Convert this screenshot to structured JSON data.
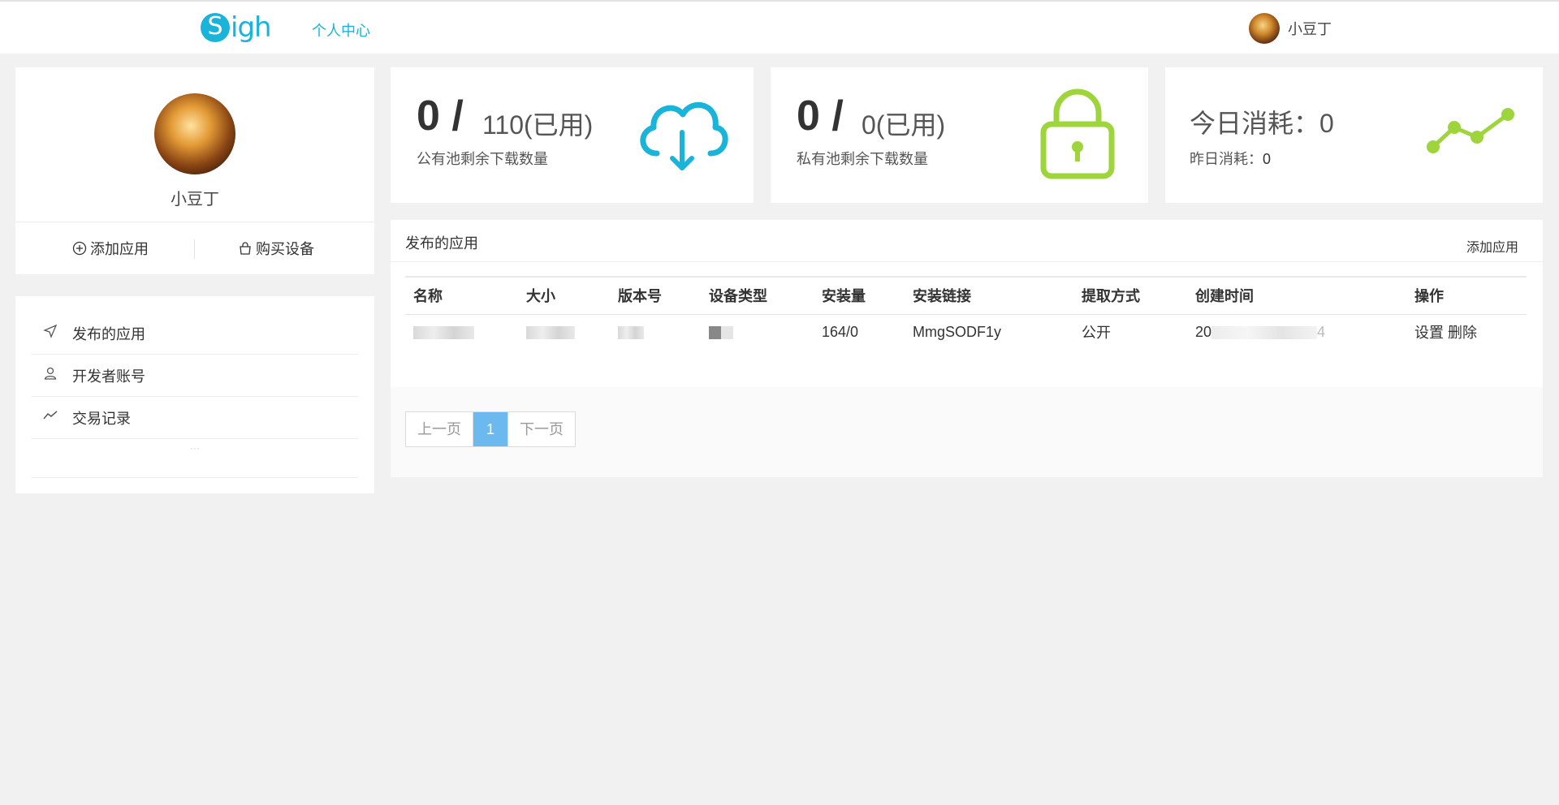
{
  "header": {
    "logo_letter": "S",
    "logo_rest": "igh",
    "nav_center": "个人中心",
    "username": "小豆丁"
  },
  "profile": {
    "name": "小豆丁",
    "add_app": "添加应用",
    "buy_device": "购买设备"
  },
  "menu": {
    "items": [
      {
        "label": "发布的应用",
        "icon": "send-icon"
      },
      {
        "label": "开发者账号",
        "icon": "user-icon"
      },
      {
        "label": "交易记录",
        "icon": "trend-icon"
      }
    ],
    "more": "···"
  },
  "stats": {
    "public": {
      "big": "0 /",
      "used": "110(已用)",
      "sub": "公有池剩余下载数量",
      "icon": "cloud-download-icon",
      "color": "#1ab3d9"
    },
    "private": {
      "big": "0 /",
      "used": "0(已用)",
      "sub": "私有池剩余下载数量",
      "icon": "lock-icon",
      "color": "#9ed43c"
    },
    "consume": {
      "today": "今日消耗：0",
      "yesterday_label": "昨日消耗：",
      "yesterday_value": "0",
      "icon": "line-chart-icon",
      "color": "#9ed43c"
    }
  },
  "apps": {
    "title": "发布的应用",
    "add_button": "添加应用",
    "columns": [
      "名称",
      "大小",
      "版本号",
      "设备类型",
      "安装量",
      "安装链接",
      "提取方式",
      "创建时间",
      "操作"
    ],
    "rows": [
      {
        "installs": "164/0",
        "link": "MmgSODF1y",
        "method": "公开",
        "created_prefix": "20",
        "created_suffix": "4",
        "op_settings": "设置",
        "op_delete": "删除"
      }
    ],
    "pager": {
      "prev": "上一页",
      "current": "1",
      "next": "下一页"
    }
  }
}
